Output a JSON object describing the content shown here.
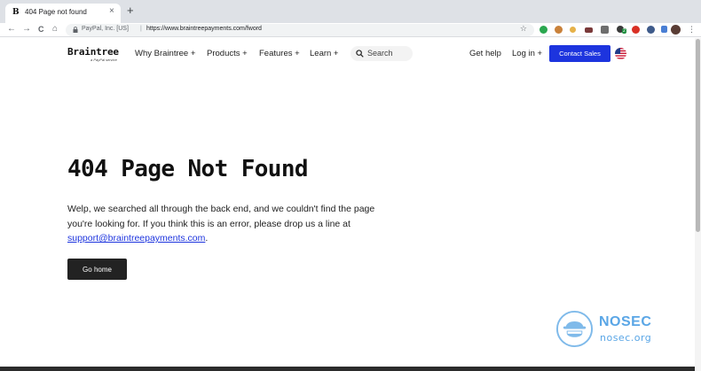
{
  "browser": {
    "tab": {
      "favicon": "B",
      "title": "404 Page not found",
      "close": "×"
    },
    "new_tab": "+",
    "nav": {
      "back": "←",
      "forward": "→",
      "reload": "C",
      "home": "⌂"
    },
    "omnibox": {
      "site_id": "PayPal, Inc. [US]",
      "separator": "|",
      "url": "https://www.braintreepayments.com/fword",
      "star": "☆"
    },
    "menu": "⋮",
    "extension_badge": "2"
  },
  "header": {
    "logo": {
      "word": "Braintree",
      "sub": "a PayPal service"
    },
    "nav": [
      "Why Braintree +",
      "Products +",
      "Features +",
      "Learn +"
    ],
    "search_label": "Search",
    "get_help": "Get help",
    "log_in": "Log in +",
    "contact_sales": "Contact Sales"
  },
  "main": {
    "heading": "404 Page Not Found",
    "body_lines": [
      "Welp, we searched all through the back end, and we couldn't find the page",
      "you're looking for. If you think this is an error, please drop us a line at"
    ],
    "support_email": "support@braintreepayments.com",
    "support_suffix": ".",
    "go_home": "Go home"
  },
  "watermark": {
    "title": "NOSEC",
    "url": "nosec.org"
  },
  "colors": {
    "accent": "#1d34de",
    "watermark": "#5aa6e6",
    "tabstrip": "#dee1e6"
  }
}
